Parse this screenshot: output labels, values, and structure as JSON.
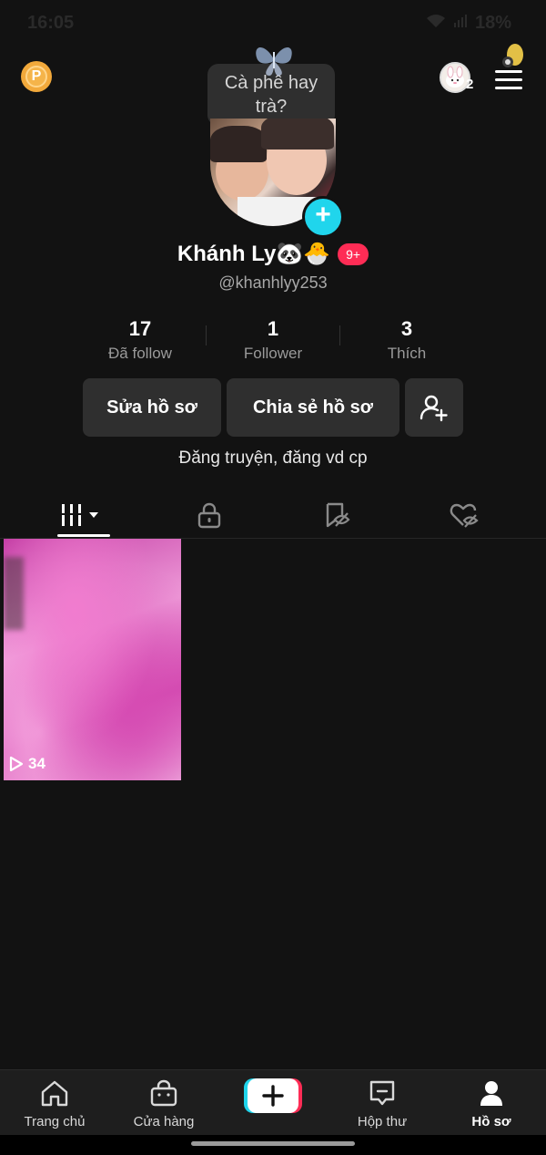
{
  "status_bar": {
    "time": "16:05",
    "battery": "18%"
  },
  "top_bar": {
    "coin_label": "P",
    "friends_count": "2"
  },
  "note": {
    "text": "Cà phê hay trà?"
  },
  "profile": {
    "display_name": "Khánh Ly🐼🐣",
    "notification_badge": "9+",
    "username": "@khanhlyy253",
    "bio": "Đăng truyện, đăng vd cp"
  },
  "stats": [
    {
      "value": "17",
      "label": "Đã follow"
    },
    {
      "value": "1",
      "label": "Follower"
    },
    {
      "value": "3",
      "label": "Thích"
    }
  ],
  "buttons": {
    "edit_profile": "Sửa hồ sơ",
    "share_profile": "Chia sẻ hồ sơ"
  },
  "tabs": [
    "videos-grid",
    "private",
    "reposts",
    "liked"
  ],
  "videos": [
    {
      "views": "34"
    }
  ],
  "bottom_nav": [
    {
      "label": "Trang chủ",
      "icon": "home-icon"
    },
    {
      "label": "Cửa hàng",
      "icon": "shop-bag-icon"
    },
    {
      "label": "",
      "icon": "create-plus-icon"
    },
    {
      "label": "Hộp thư",
      "icon": "inbox-icon"
    },
    {
      "label": "Hồ sơ",
      "icon": "profile-icon"
    }
  ],
  "colors": {
    "background": "#121212",
    "accent_red": "#fe2c55",
    "accent_cyan": "#20d5ec",
    "button_bg": "#2f2f2f"
  }
}
